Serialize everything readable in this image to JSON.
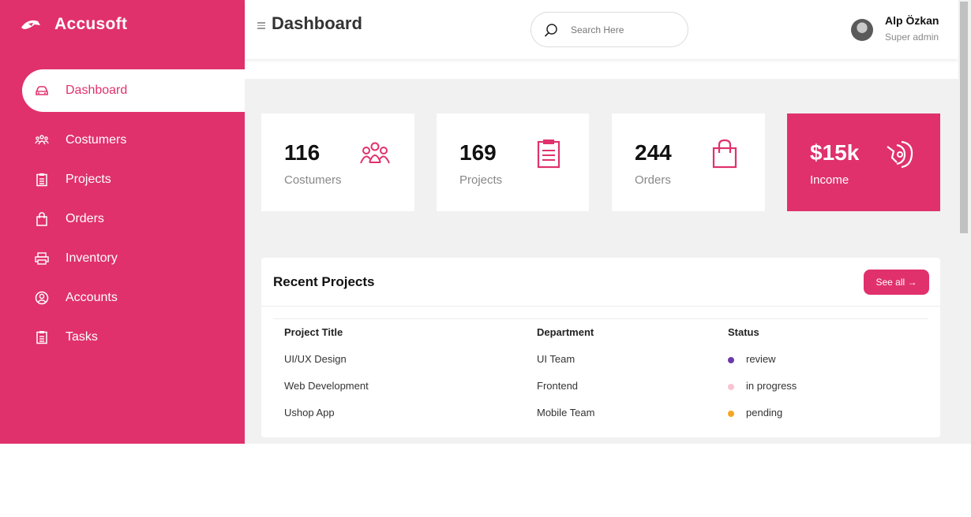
{
  "brand": {
    "name": "Accusoft"
  },
  "sidebar": {
    "items": [
      {
        "label": "Dashboard",
        "icon": "car-icon",
        "active": true
      },
      {
        "label": "Costumers",
        "icon": "people-icon"
      },
      {
        "label": "Projects",
        "icon": "clipboard-icon"
      },
      {
        "label": "Orders",
        "icon": "bag-icon"
      },
      {
        "label": "Inventory",
        "icon": "printer-icon"
      },
      {
        "label": "Accounts",
        "icon": "user-circle-icon"
      },
      {
        "label": "Tasks",
        "icon": "clipboard-icon"
      }
    ]
  },
  "header": {
    "title": "Dashboard",
    "search_placeholder": "Search Here",
    "user": {
      "name": "Alp Özkan",
      "role": "Super admin"
    }
  },
  "cards": [
    {
      "value": "116",
      "label": "Costumers",
      "icon": "people-icon"
    },
    {
      "value": "169",
      "label": "Projects",
      "icon": "clipboard-icon"
    },
    {
      "value": "244",
      "label": "Orders",
      "icon": "bag-icon"
    },
    {
      "value": "$15k",
      "label": "Income",
      "icon": "money-icon"
    }
  ],
  "recent": {
    "title": "Recent Projects",
    "see_all": "See all →",
    "columns": [
      "Project Title",
      "Department",
      "Status"
    ],
    "rows": [
      {
        "title": "UI/UX Design",
        "department": "UI Team",
        "status": "review",
        "status_color": "#6a3aa8"
      },
      {
        "title": "Web Development",
        "department": "Frontend",
        "status": "in progress",
        "status_color": "#f9c4d2"
      },
      {
        "title": "Ushop App",
        "department": "Mobile Team",
        "status": "pending",
        "status_color": "#f5a623"
      }
    ]
  },
  "colors": {
    "accent": "#e0316d",
    "background": "#f1f1f1"
  }
}
